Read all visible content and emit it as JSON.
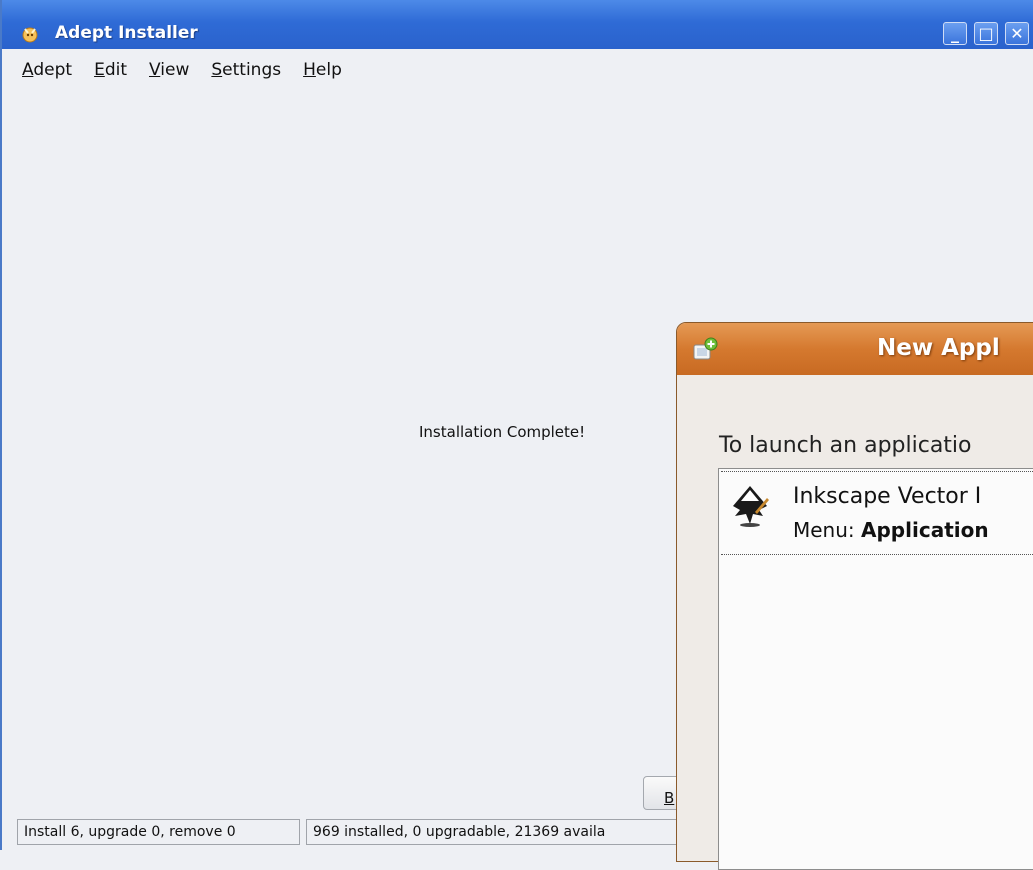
{
  "window": {
    "title": "Adept Installer",
    "controls": [
      "minimize",
      "maximize",
      "close"
    ]
  },
  "menu": [
    {
      "label": "Adept",
      "mnemonic": "A",
      "rest": "dept"
    },
    {
      "label": "Edit",
      "mnemonic": "E",
      "rest": "dit"
    },
    {
      "label": "View",
      "mnemonic": "V",
      "rest": "iew"
    },
    {
      "label": "Settings",
      "mnemonic": "S",
      "rest": "ettings"
    },
    {
      "label": "Help",
      "mnemonic": "H",
      "rest": "elp"
    }
  ],
  "main": {
    "status_message": "Installation Complete!",
    "back_button_label": "B",
    "back_button_mnemonic": "B"
  },
  "statusbar": {
    "changes": "Install 6, upgrade 0, remove 0",
    "summary": "969 installed, 0 upgradable, 21369 availa"
  },
  "dialog": {
    "title": "New Appl",
    "message": "To launch an applicatio",
    "app": {
      "name": "Inkscape Vector I",
      "menu_prefix": "Menu:",
      "menu_path": "Application"
    }
  },
  "colors": {
    "titlebar": "#2f6bd6",
    "dialog_titlebar": "#d5792f",
    "background": "#eef0f4"
  }
}
